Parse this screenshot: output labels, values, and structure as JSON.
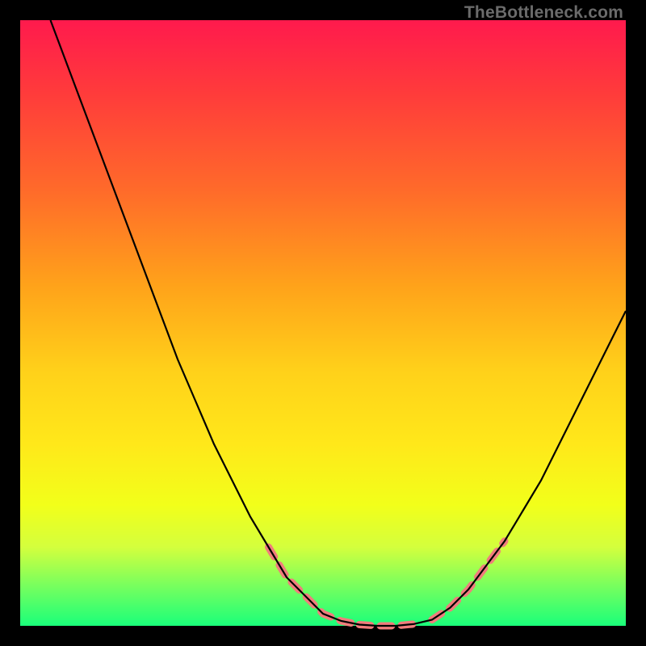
{
  "watermark": "TheBottleneck.com",
  "chart_data": {
    "type": "line",
    "title": "",
    "xlabel": "",
    "ylabel": "",
    "xlim": [
      0,
      100
    ],
    "ylim": [
      0,
      100
    ],
    "series": [
      {
        "name": "bottleneck-curve",
        "style": "solid-black",
        "x": [
          5,
          8,
          11,
          14,
          17,
          20,
          23,
          26,
          29,
          32,
          35,
          38,
          41,
          44,
          47,
          50,
          53,
          56,
          59,
          62,
          65,
          68,
          71,
          74,
          77,
          80,
          83,
          86,
          89,
          92,
          95,
          98,
          100
        ],
        "y": [
          100,
          92,
          84,
          76,
          68,
          60,
          52,
          44,
          37,
          30,
          24,
          18,
          13,
          8,
          5,
          2,
          0.8,
          0.2,
          0,
          0,
          0.3,
          1,
          3,
          6,
          10,
          14,
          19,
          24,
          30,
          36,
          42,
          48,
          52
        ]
      },
      {
        "name": "dashed-left-segment",
        "style": "dashed-salmon",
        "x": [
          41,
          44,
          47,
          50,
          53,
          56
        ],
        "y": [
          13,
          8,
          5,
          2,
          0.8,
          0.2
        ]
      },
      {
        "name": "dashed-valley-segment",
        "style": "dashed-salmon",
        "x": [
          56,
          59,
          62,
          65
        ],
        "y": [
          0.2,
          0,
          0,
          0.3
        ]
      },
      {
        "name": "dashed-right-segment",
        "style": "dashed-salmon",
        "x": [
          68,
          71,
          74,
          77,
          80
        ],
        "y": [
          1,
          3,
          6,
          10,
          14
        ]
      }
    ],
    "grid": false,
    "legend": false
  }
}
